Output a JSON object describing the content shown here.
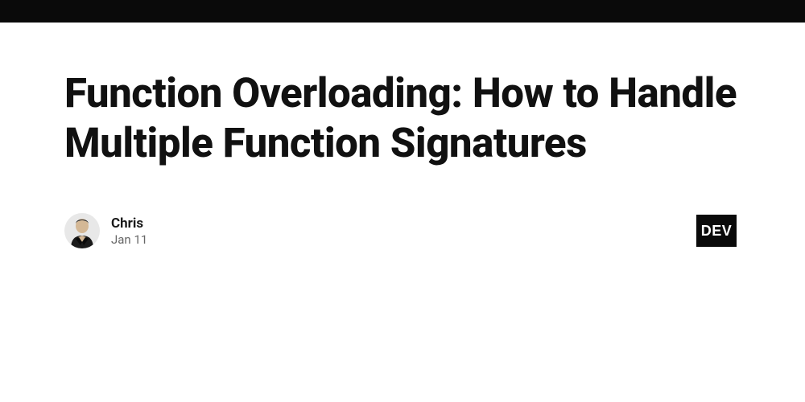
{
  "article": {
    "title": "Function Overloading: How to Handle Multiple Function Signatures"
  },
  "author": {
    "name": "Chris",
    "date": "Jan 11"
  },
  "brand": {
    "badge": "DEV"
  }
}
